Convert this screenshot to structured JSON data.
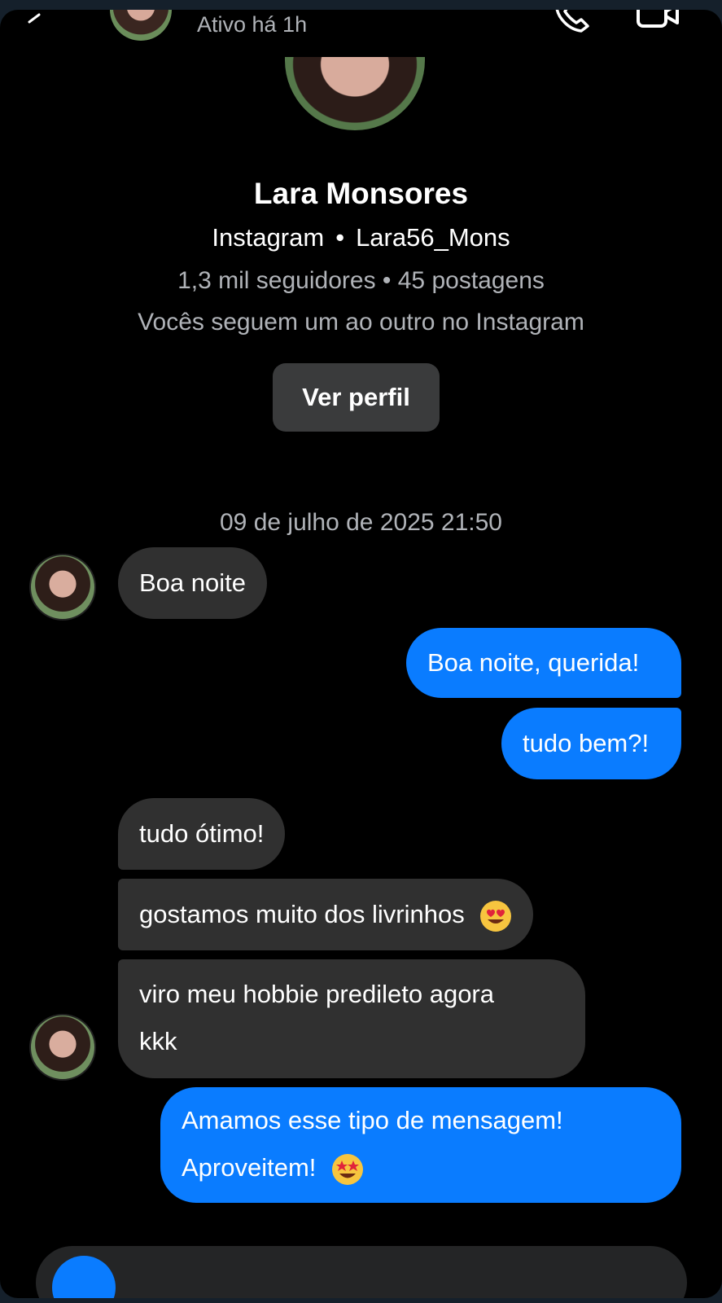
{
  "header": {
    "active_status": "Ativo há 1h"
  },
  "profile": {
    "name": "Lara Monsores",
    "platform": "Instagram",
    "separator": "•",
    "username": "Lara56_Mons",
    "stats": "1,3 mil seguidores • 45 postagens",
    "mutual": "Vocês seguem um ao outro no Instagram",
    "view_profile_label": "Ver perfil"
  },
  "conversation": {
    "timestamp": "09 de julho de 2025 21:50",
    "messages": [
      {
        "sender": "contact",
        "text": "Boa noite"
      },
      {
        "sender": "me",
        "text": "Boa noite, querida!"
      },
      {
        "sender": "me",
        "text": "tudo bem?!"
      },
      {
        "sender": "contact",
        "text": "tudo ótimo!"
      },
      {
        "sender": "contact",
        "text": "gostamos muito dos livrinhos",
        "emoji": "heart-eyes-emoji"
      },
      {
        "sender": "contact",
        "text_line1": "viro meu hobbie predileto agora",
        "text_line2": "kkk"
      },
      {
        "sender": "me",
        "text_line1": "Amamos esse tipo de mensagem!",
        "text_line2": "Aproveitem!",
        "emoji": "star-struck-emoji"
      }
    ]
  },
  "colors": {
    "background": "#000000",
    "incoming_bubble": "#303030",
    "outgoing_bubble": "#0a7cff",
    "secondary_text": "#b0b3b8"
  }
}
